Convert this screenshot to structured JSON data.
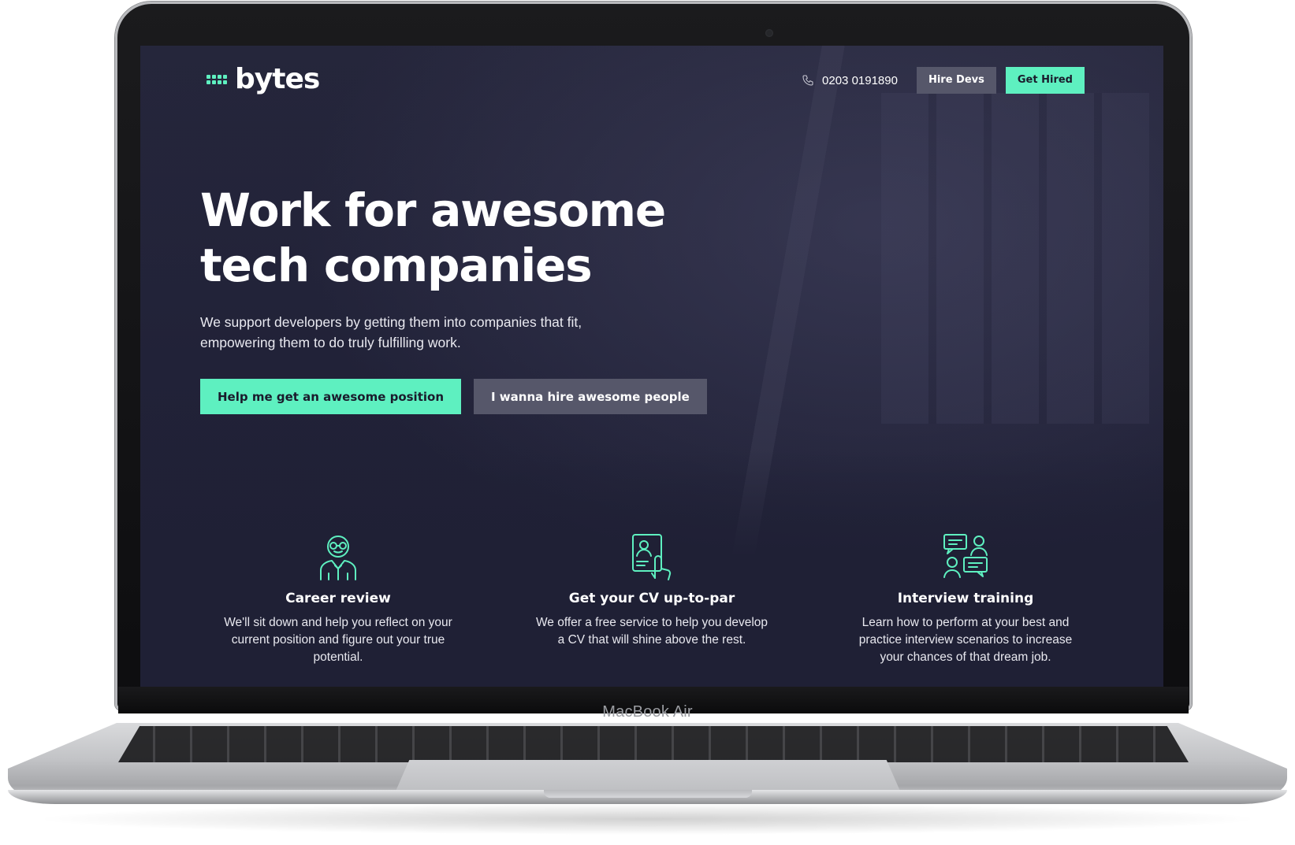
{
  "device": {
    "model_label": "MacBook Air"
  },
  "site": {
    "logo": {
      "text": "bytes",
      "icon": "dot-grid-icon"
    },
    "nav": {
      "phone_icon": "phone-icon",
      "phone": "0203 0191890",
      "hire_devs_label": "Hire Devs",
      "get_hired_label": "Get Hired"
    },
    "hero": {
      "title_line1": "Work for awesome",
      "title_line2": "tech companies",
      "subtitle_line1": "We support developers by getting them into companies that fit,",
      "subtitle_line2": "empowering them to do truly fulfilling work.",
      "primary_cta": "Help me get an awesome position",
      "secondary_cta": "I wanna hire awesome people"
    },
    "features": [
      {
        "icon": "person-glasses-icon",
        "title": "Career review",
        "text": "We'll sit down and help you reflect on your current position and figure out your true potential."
      },
      {
        "icon": "cv-document-icon",
        "title": "Get your CV up-to-par",
        "text": "We offer a free service to help you develop a CV that will shine above the rest."
      },
      {
        "icon": "chat-people-icon",
        "title": "Interview training",
        "text": "Learn how to perform at your best and practice interview scenarios to increase your chances of that dream job."
      }
    ]
  },
  "colors": {
    "accent": "#5ef0c0",
    "background": "#22233a",
    "secondary_button": "#56576a"
  }
}
